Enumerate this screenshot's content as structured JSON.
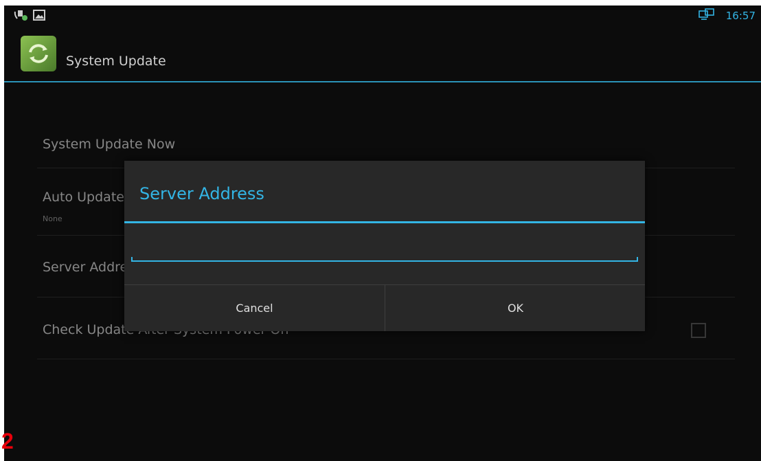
{
  "status_bar": {
    "time": "16:57",
    "icons": [
      "call-storage-icon",
      "image-icon",
      "network-monitor-icon"
    ]
  },
  "action_bar": {
    "title": "System Update",
    "app_icon": "system-update-icon"
  },
  "preferences": [
    {
      "title": "System Update Now",
      "summary": ""
    },
    {
      "title": "Auto Update",
      "summary": "None"
    },
    {
      "title": "Server Address",
      "summary": ""
    },
    {
      "title": "Check Update After System Power On",
      "summary": "",
      "checked": false
    }
  ],
  "dialog": {
    "title": "Server Address",
    "input_value": "",
    "cancel_label": "Cancel",
    "ok_label": "OK"
  },
  "step_badge": "2",
  "colors": {
    "accent": "#33b5e5",
    "background": "#0c0c0c",
    "dialog_bg": "#282828",
    "badge": "#e8000b"
  }
}
